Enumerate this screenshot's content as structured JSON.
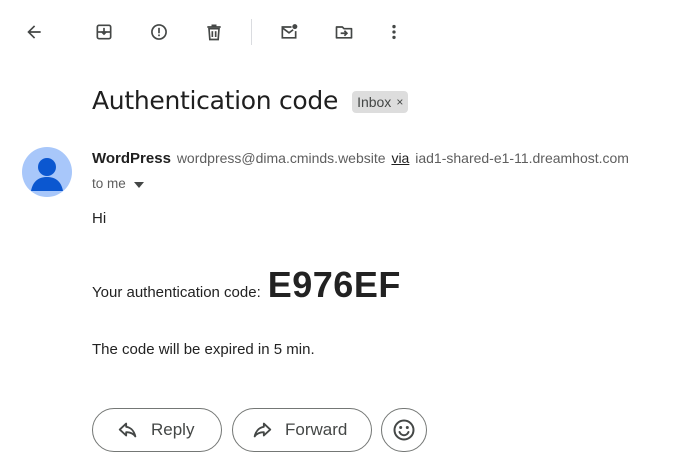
{
  "toolbar": {
    "icons": [
      "back-arrow-icon",
      "archive-icon",
      "report-spam-icon",
      "delete-icon",
      "mark-unread-icon",
      "move-to-icon",
      "more-options-icon"
    ]
  },
  "email": {
    "subject": "Authentication code",
    "label": "Inbox",
    "label_remove": "×",
    "sender_name": "WordPress",
    "sender_email": "wordpress@dima.cminds.website",
    "via_text": "via",
    "via_host": "iad1-shared-e1-11.dreamhost.com",
    "recipient": "to me",
    "greeting": "Hi",
    "code_label": "Your authentication code:",
    "code": "E976EF",
    "expiry_text": "The code will be expired in 5 min."
  },
  "actions": {
    "reply_label": "Reply",
    "forward_label": "Forward"
  },
  "colors": {
    "avatar_bg": "#a8c7fa",
    "avatar_fg": "#0b57d0",
    "icon": "#444746",
    "chip_bg": "#dddddd"
  }
}
